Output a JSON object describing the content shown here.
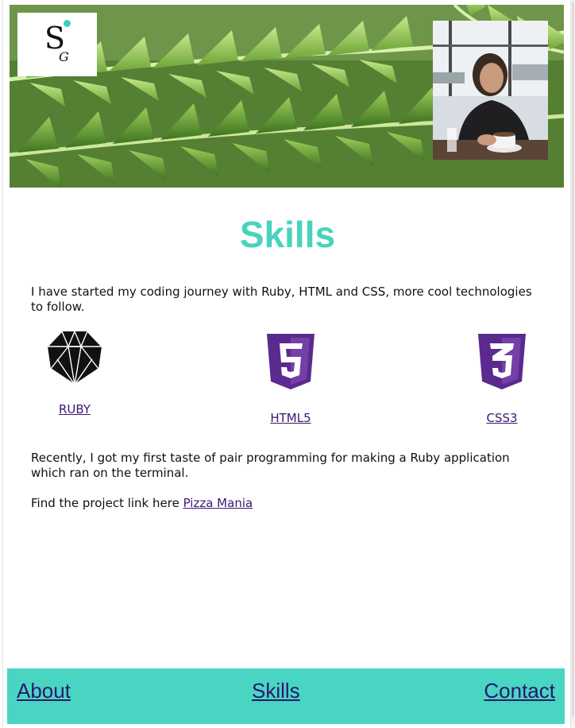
{
  "header": {
    "logo_letter": "S",
    "logo_sub_letter": "G",
    "accent_color": "#48d3bd"
  },
  "main": {
    "title": "Skills",
    "intro": "I have started my coding journey with Ruby, HTML and CSS, more cool technologies to follow.",
    "skills": [
      {
        "label": "RUBY",
        "icon": "ruby-gem-icon"
      },
      {
        "label": "HTML5",
        "icon": "html5-shield-icon"
      },
      {
        "label": "CSS3",
        "icon": "css3-shield-icon"
      }
    ],
    "pair_programming": "Recently, I got my first taste of pair programming for making a Ruby application which ran on the terminal.",
    "project_prefix": "Find the project link here",
    "project_link": "Pizza Mania"
  },
  "footer": {
    "links": [
      "About",
      "Skills",
      "Contact"
    ],
    "background": "#48d6c2",
    "link_color": "#2b1670"
  }
}
